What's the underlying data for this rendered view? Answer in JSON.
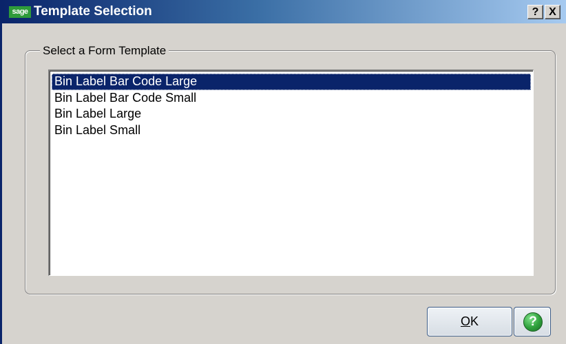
{
  "window": {
    "logo_text": "sage",
    "title": "Template Selection",
    "help_glyph": "?",
    "close_glyph": "X"
  },
  "group": {
    "legend": "Select a Form Template"
  },
  "templates": {
    "items": [
      "Bin Label Bar Code Large",
      "Bin Label Bar Code Small",
      "Bin Label Large",
      "Bin Label Small"
    ],
    "selected_index": 0
  },
  "buttons": {
    "ok_mnemonic": "O",
    "ok_rest": "K",
    "help_glyph": "?"
  },
  "colors": {
    "titlebar_start": "#0a246a",
    "titlebar_end": "#a6caf0",
    "selection": "#0a246a",
    "sage_green": "#2e9b3a",
    "dialog_face": "#d6d3ce"
  },
  "icons": {
    "logo": "sage-logo-icon",
    "title_help": "question-mark-icon",
    "title_close": "close-icon",
    "help_button": "green-help-icon"
  }
}
